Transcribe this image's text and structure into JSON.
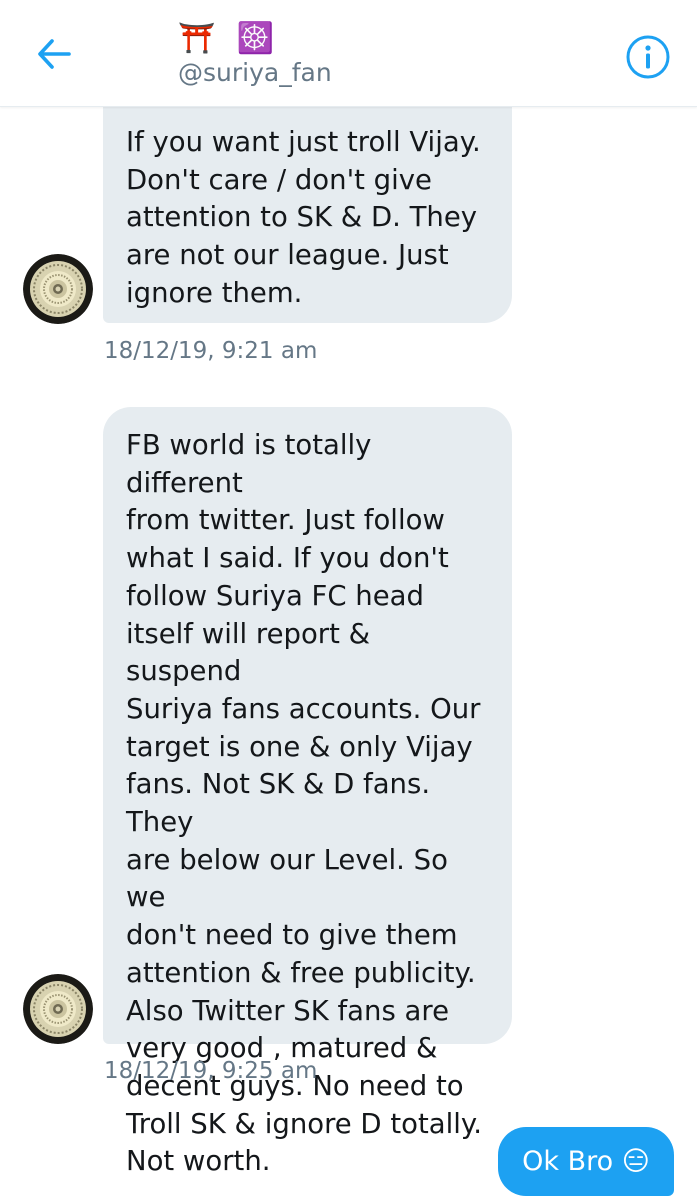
{
  "header": {
    "title_emoji": "⛩️ ☸️",
    "handle": "@suriya_fan",
    "back_icon": "back-arrow-icon",
    "info_icon": "info-icon",
    "accent_color": "#1da1f2"
  },
  "messages": [
    {
      "direction": "incoming",
      "text": "If you want just troll Vijay.\nDon't care / don't give\nattention to SK & D. They\nare not our league. Just\nignore them.",
      "timestamp": "18/12/19, 9:21 am"
    },
    {
      "direction": "incoming",
      "text": "FB world is totally different\nfrom twitter. Just follow\nwhat I said. If you don't\nfollow Suriya FC head\nitself will report & suspend\nSuriya fans accounts. Our\ntarget is one & only Vijay\nfans. Not SK & D fans. They\nare below our Level. So we\ndon't need to give them\nattention & free publicity.\nAlso Twitter SK fans are\nvery good , matured &\ndecent guys. No need to\nTroll SK & ignore D totally.\nNot worth.",
      "timestamp": "18/12/19, 9:25 am"
    },
    {
      "direction": "outgoing",
      "text": "Ok Bro 😑"
    }
  ],
  "colors": {
    "incoming_bubble": "#e6ecf0",
    "outgoing_bubble": "#1da1f2",
    "timestamp": "#657786"
  }
}
